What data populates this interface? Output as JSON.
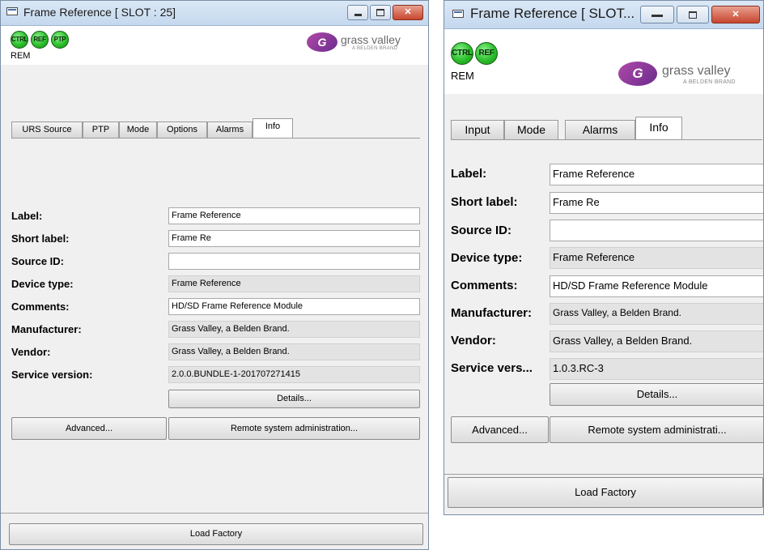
{
  "window1": {
    "title": "Frame Reference [ SLOT : 25]",
    "leds": [
      "CTRL",
      "REF",
      "PTP"
    ],
    "rem": "REM",
    "logo": {
      "text": "grass valley",
      "sub": "A BELDEN BRAND"
    },
    "tabs": [
      "URS Source",
      "PTP",
      "Mode",
      "Options",
      "Alarms",
      "Info"
    ],
    "active_tab": "Info",
    "fields": [
      {
        "label": "Label:",
        "value": "Frame Reference",
        "editable": true
      },
      {
        "label": "Short label:",
        "value": "Frame Re",
        "editable": true
      },
      {
        "label": "Source ID:",
        "value": "",
        "editable": true
      },
      {
        "label": "Device type:",
        "value": "Frame Reference",
        "editable": false
      },
      {
        "label": "Comments:",
        "value": "HD/SD Frame Reference Module",
        "editable": true
      },
      {
        "label": "Manufacturer:",
        "value": "Grass Valley, a Belden Brand.",
        "editable": false
      },
      {
        "label": "Vendor:",
        "value": "Grass Valley, a Belden Brand.",
        "editable": false
      },
      {
        "label": "Service version:",
        "value": "2.0.0.BUNDLE-1-201707271415",
        "editable": false
      }
    ],
    "details_label": "Details...",
    "advanced_label": "Advanced...",
    "remote_label": "Remote system administration...",
    "load_factory_label": "Load Factory"
  },
  "window2": {
    "title": "Frame Reference [ SLOT...",
    "leds": [
      "CTRL",
      "REF"
    ],
    "rem": "REM",
    "logo": {
      "text": "grass valley",
      "sub": "A BELDEN BRAND"
    },
    "tabs": [
      "Input",
      "Mode",
      "Alarms",
      "Info"
    ],
    "active_tab": "Info",
    "fields": [
      {
        "label": "Label:",
        "value": "Frame Reference",
        "editable": true
      },
      {
        "label": "Short label:",
        "value": "Frame Re",
        "editable": true
      },
      {
        "label": "Source ID:",
        "value": "",
        "editable": true
      },
      {
        "label": "Device type:",
        "value": "Frame Reference",
        "editable": false
      },
      {
        "label": "Comments:",
        "value": "HD/SD Frame Reference Module",
        "editable": true
      },
      {
        "label": "Manufacturer:",
        "value": "Grass Valley, a Belden Brand.",
        "editable": false
      },
      {
        "label": "Vendor:",
        "value": "Grass Valley, a Belden Brand.",
        "editable": false
      },
      {
        "label": "Service vers...",
        "value": "1.0.3.RC-3",
        "editable": false
      }
    ],
    "details_label": "Details...",
    "advanced_label": "Advanced...",
    "remote_label": "Remote system administrati...",
    "load_factory_label": "Load Factory"
  }
}
